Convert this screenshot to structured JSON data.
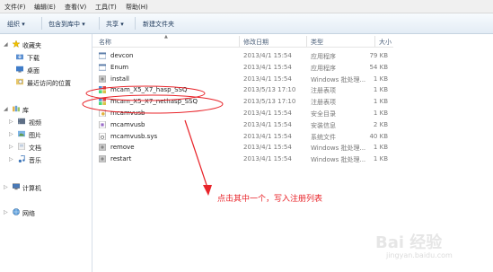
{
  "menu": [
    "文件(F)",
    "编辑(E)",
    "查看(V)",
    "工具(T)",
    "帮助(H)"
  ],
  "toolbar": {
    "organize": "组织 ▾",
    "include": "包含到库中 ▾",
    "share": "共享 ▾",
    "new_folder": "新建文件夹"
  },
  "nav": {
    "favorites": "收藏夹",
    "downloads": "下载",
    "desktop": "桌面",
    "recent": "最近访问的位置",
    "libraries": "库",
    "videos": "视频",
    "pictures": "图片",
    "documents": "文档",
    "music": "音乐",
    "computer": "计算机",
    "network": "网络"
  },
  "columns": {
    "name": "名称",
    "date": "修改日期",
    "type": "类型",
    "size": "大小"
  },
  "files": [
    {
      "name": "devcon",
      "date": "2013/4/1 15:54",
      "type": "应用程序",
      "size": "79 KB",
      "icon": "exe-icon"
    },
    {
      "name": "Enum",
      "date": "2013/4/1 15:54",
      "type": "应用程序",
      "size": "54 KB",
      "icon": "exe-icon"
    },
    {
      "name": "install",
      "date": "2013/4/1 15:54",
      "type": "Windows 批处理...",
      "size": "1 KB",
      "icon": "bat-icon"
    },
    {
      "name": "mcam_X5_X7_hasp_SSQ",
      "date": "2013/5/13 17:10",
      "type": "注册表项",
      "size": "1 KB",
      "icon": "reg-icon"
    },
    {
      "name": "mcam_X5_X7_nethasp_SSQ",
      "date": "2013/5/13 17:10",
      "type": "注册表项",
      "size": "1 KB",
      "icon": "reg-icon"
    },
    {
      "name": "mcamvusb",
      "date": "2013/4/1 15:54",
      "type": "安全目录",
      "size": "1 KB",
      "icon": "cat-icon"
    },
    {
      "name": "mcamvusb",
      "date": "2013/4/1 15:54",
      "type": "安装信息",
      "size": "2 KB",
      "icon": "inf-icon"
    },
    {
      "name": "mcamvusb.sys",
      "date": "2013/4/1 15:54",
      "type": "系统文件",
      "size": "40 KB",
      "icon": "sys-icon"
    },
    {
      "name": "remove",
      "date": "2013/4/1 15:54",
      "type": "Windows 批处理...",
      "size": "1 KB",
      "icon": "bat-icon"
    },
    {
      "name": "restart",
      "date": "2013/4/1 15:54",
      "type": "Windows 批处理...",
      "size": "1 KB",
      "icon": "bat-icon"
    }
  ],
  "annotation": "点击其中一个，写入注册列表",
  "watermark": {
    "logo": "Bai 经验",
    "url": "jingyan.baidu.com"
  },
  "colors": {
    "annotation": "#e8242a",
    "toolbar_text": "#1e395b"
  }
}
